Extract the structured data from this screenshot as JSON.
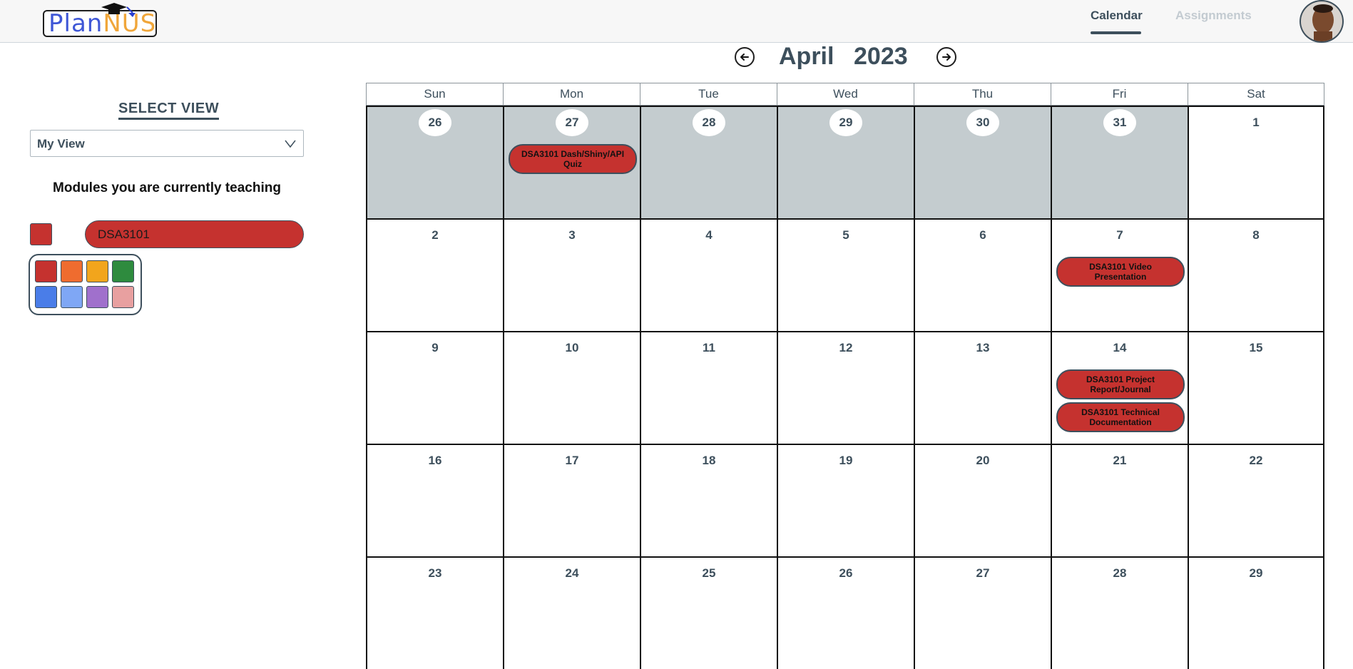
{
  "app": {
    "logo_text_part1": "Plan",
    "logo_text_part2": "NUS"
  },
  "nav": {
    "calendar_label": "Calendar",
    "assignments_label": "Assignments"
  },
  "month_nav": {
    "month": "April",
    "year": "2023"
  },
  "sidebar": {
    "select_view_title": "SELECT VIEW",
    "view_selected": "My View",
    "teaching_title": "Modules you are currently teaching",
    "modules": [
      {
        "code": "DSA3101",
        "color": "#c5322f"
      }
    ],
    "palette_colors": [
      "#c5322f",
      "#ef6c2f",
      "#f2a51c",
      "#2e8b3e",
      "#4a7de8",
      "#7fa7f5",
      "#a070cc",
      "#e8a0a0"
    ]
  },
  "calendar": {
    "weekdays": [
      "Sun",
      "Mon",
      "Tue",
      "Wed",
      "Thu",
      "Fri",
      "Sat"
    ],
    "weeks": [
      [
        {
          "day": "26",
          "prev_month": true
        },
        {
          "day": "27",
          "prev_month": true,
          "events": [
            "DSA3101 Dash/Shiny/API Quiz"
          ]
        },
        {
          "day": "28",
          "prev_month": true
        },
        {
          "day": "29",
          "prev_month": true
        },
        {
          "day": "30",
          "prev_month": true
        },
        {
          "day": "31",
          "prev_month": true
        },
        {
          "day": "1"
        }
      ],
      [
        {
          "day": "2"
        },
        {
          "day": "3"
        },
        {
          "day": "4"
        },
        {
          "day": "5"
        },
        {
          "day": "6"
        },
        {
          "day": "7",
          "events": [
            "DSA3101 Video Presentation"
          ]
        },
        {
          "day": "8"
        }
      ],
      [
        {
          "day": "9"
        },
        {
          "day": "10"
        },
        {
          "day": "11"
        },
        {
          "day": "12"
        },
        {
          "day": "13"
        },
        {
          "day": "14",
          "events": [
            "DSA3101 Project Report/Journal",
            "DSA3101 Technical Documentation"
          ]
        },
        {
          "day": "15"
        }
      ],
      [
        {
          "day": "16"
        },
        {
          "day": "17"
        },
        {
          "day": "18"
        },
        {
          "day": "19"
        },
        {
          "day": "20"
        },
        {
          "day": "21"
        },
        {
          "day": "22"
        }
      ],
      [
        {
          "day": "23"
        },
        {
          "day": "24"
        },
        {
          "day": "25"
        },
        {
          "day": "26"
        },
        {
          "day": "27"
        },
        {
          "day": "28"
        },
        {
          "day": "29"
        }
      ]
    ],
    "event_color": "#c5322f"
  }
}
